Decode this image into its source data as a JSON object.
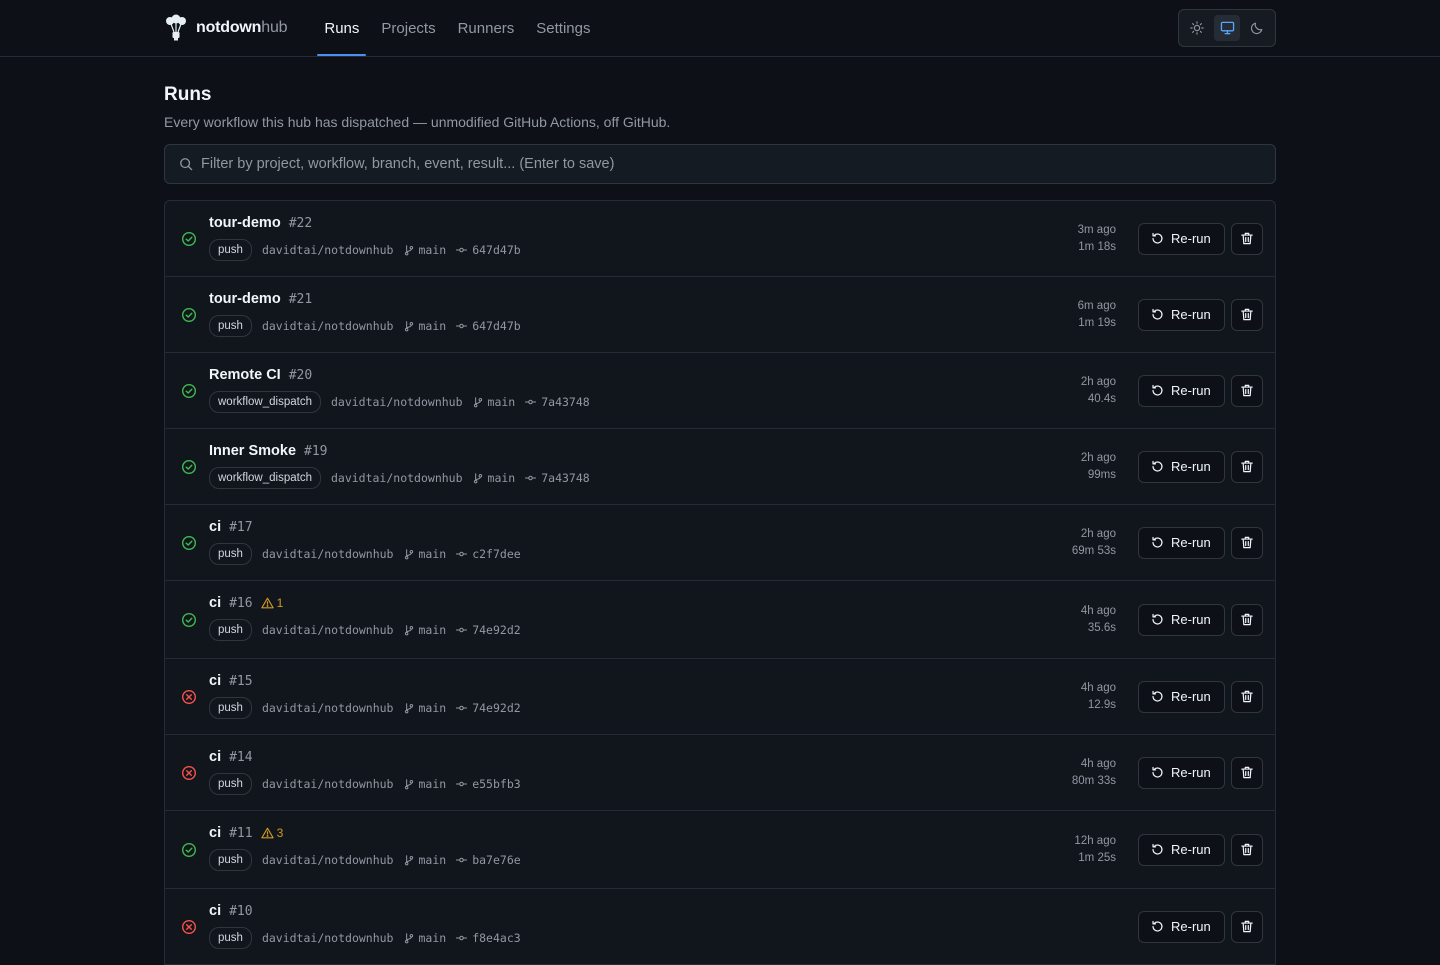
{
  "brand": {
    "name_a": "notdown",
    "name_b": "hub"
  },
  "nav": [
    {
      "label": "Runs",
      "active": true
    },
    {
      "label": "Projects",
      "active": false
    },
    {
      "label": "Runners",
      "active": false
    },
    {
      "label": "Settings",
      "active": false
    }
  ],
  "theme": {
    "options": [
      "sun-icon",
      "monitor-icon",
      "moon-icon"
    ],
    "selected": "monitor-icon"
  },
  "page": {
    "title": "Runs",
    "subtitle": "Every workflow this hub has dispatched — unmodified GitHub Actions, off GitHub."
  },
  "filter": {
    "placeholder": "Filter by project, workflow, branch, event, result... (Enter to save)",
    "value": ""
  },
  "actions": {
    "rerun_label": "Re-run"
  },
  "colors": {
    "success": "#3fb950",
    "failure": "#f85149",
    "warning": "#d29922",
    "accent": "#4c8df6"
  },
  "runs": [
    {
      "status": "success",
      "name": "tour-demo",
      "number": "#22",
      "warnings": "",
      "event": "push",
      "repo": "davidtai/notdownhub",
      "branch": "main",
      "commit": "647d47b",
      "ago": "3m ago",
      "duration": "1m 18s"
    },
    {
      "status": "success",
      "name": "tour-demo",
      "number": "#21",
      "warnings": "",
      "event": "push",
      "repo": "davidtai/notdownhub",
      "branch": "main",
      "commit": "647d47b",
      "ago": "6m ago",
      "duration": "1m 19s"
    },
    {
      "status": "success",
      "name": "Remote CI",
      "number": "#20",
      "warnings": "",
      "event": "workflow_dispatch",
      "repo": "davidtai/notdownhub",
      "branch": "main",
      "commit": "7a43748",
      "ago": "2h ago",
      "duration": "40.4s"
    },
    {
      "status": "success",
      "name": "Inner Smoke",
      "number": "#19",
      "warnings": "",
      "event": "workflow_dispatch",
      "repo": "davidtai/notdownhub",
      "branch": "main",
      "commit": "7a43748",
      "ago": "2h ago",
      "duration": "99ms"
    },
    {
      "status": "success",
      "name": "ci",
      "number": "#17",
      "warnings": "",
      "event": "push",
      "repo": "davidtai/notdownhub",
      "branch": "main",
      "commit": "c2f7dee",
      "ago": "2h ago",
      "duration": "69m 53s"
    },
    {
      "status": "success",
      "name": "ci",
      "number": "#16",
      "warnings": "1",
      "event": "push",
      "repo": "davidtai/notdownhub",
      "branch": "main",
      "commit": "74e92d2",
      "ago": "4h ago",
      "duration": "35.6s"
    },
    {
      "status": "failure",
      "name": "ci",
      "number": "#15",
      "warnings": "",
      "event": "push",
      "repo": "davidtai/notdownhub",
      "branch": "main",
      "commit": "74e92d2",
      "ago": "4h ago",
      "duration": "12.9s"
    },
    {
      "status": "failure",
      "name": "ci",
      "number": "#14",
      "warnings": "",
      "event": "push",
      "repo": "davidtai/notdownhub",
      "branch": "main",
      "commit": "e55bfb3",
      "ago": "4h ago",
      "duration": "80m 33s"
    },
    {
      "status": "success",
      "name": "ci",
      "number": "#11",
      "warnings": "3",
      "event": "push",
      "repo": "davidtai/notdownhub",
      "branch": "main",
      "commit": "ba7e76e",
      "ago": "12h ago",
      "duration": "1m 25s"
    },
    {
      "status": "failure",
      "name": "ci",
      "number": "#10",
      "warnings": "",
      "event": "push",
      "repo": "davidtai/notdownhub",
      "branch": "main",
      "commit": "f8e4ac3",
      "ago": "",
      "duration": ""
    }
  ]
}
